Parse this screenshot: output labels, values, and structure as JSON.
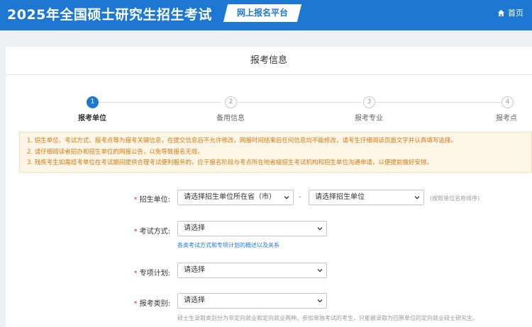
{
  "header": {
    "title": "2025年全国硕士研究生招生考试",
    "platform": "网上报名平台",
    "home_label": "首页"
  },
  "card": {
    "title": "报考信息"
  },
  "steps": [
    {
      "number": "1",
      "label": "报考单位"
    },
    {
      "number": "2",
      "label": "备用信息"
    },
    {
      "number": "3",
      "label": "报考专业"
    },
    {
      "number": "4",
      "label": "报考点"
    }
  ],
  "notice": {
    "lines": [
      "1. 招生单位、考试方式、报考点等为报考关键信息，在提交信息后不允许修改，网报时间结束后任何信息均不能修改，请考生仔细阅读页面文字并认真填写选择。",
      "2. 请仔细阅读省招办和招生单位的网报公告，以免导致报名无效。",
      "3. 残疾考生如需组考单位在考试期间提供合理考试便利服务的，应于报名阶段与考点所在地省级招生考试机构和招生单位沟通申请，以便提前做好安排。"
    ]
  },
  "form": {
    "unit": {
      "label": "招生单位:",
      "province_placeholder": "请选择招生单位所在省（市）",
      "unit_placeholder": "请选择招生单位",
      "dash": "-",
      "hint": "(按照单位名称排序)"
    },
    "exam_method": {
      "label": "考试方式:",
      "value": "请选择",
      "link": "各类考试方式和专项计划的概述以及关系"
    },
    "special_plan": {
      "label": "专项计划:",
      "value": "请选择"
    },
    "category": {
      "label": "报考类别:",
      "value": "请选择",
      "hint": "硕士生录取类别分为非定向就业和定向就业两种。参加单独考试的考生，只能被录取为回原单位的定向就业硕士研究生。"
    }
  },
  "colors": {
    "primary": "#1e78d2",
    "notice_text": "#d27a14",
    "notice_bg": "#fdf6e6",
    "required": "#e0322d"
  }
}
